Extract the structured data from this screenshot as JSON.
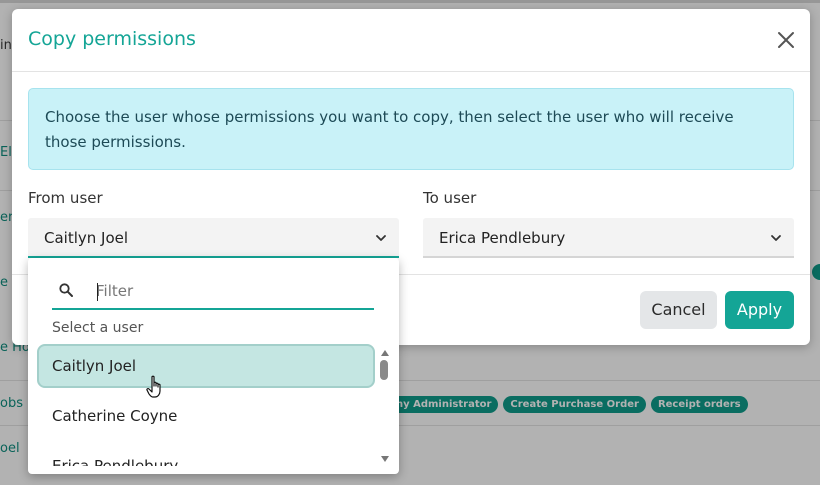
{
  "background": {
    "rows_text": [
      "in",
      "Ele",
      "erm",
      "e C",
      "e Ho",
      "obs",
      "oel"
    ],
    "tags": [
      "ny Administrator",
      "Create Purchase Order",
      "Receipt orders"
    ]
  },
  "modal": {
    "title": "Copy permissions",
    "close_icon": "close-icon",
    "info": "Choose the user whose permissions you want to copy, then select the user who will receive those permissions.",
    "from_label": "From user",
    "from_value": "Caitlyn Joel",
    "to_label": "To user",
    "to_value": "Erica Pendlebury",
    "cancel_label": "Cancel",
    "apply_label": "Apply"
  },
  "dropdown": {
    "filter_placeholder": "Filter",
    "group_label": "Select a user",
    "options": [
      "Caitlyn Joel",
      "Catherine Coyne",
      "Erica Pendlebury"
    ],
    "selected_index": 0
  },
  "colors": {
    "accent": "#14a596",
    "info_bg": "#c9f2f8",
    "selected_bg": "#c4e6e2"
  }
}
